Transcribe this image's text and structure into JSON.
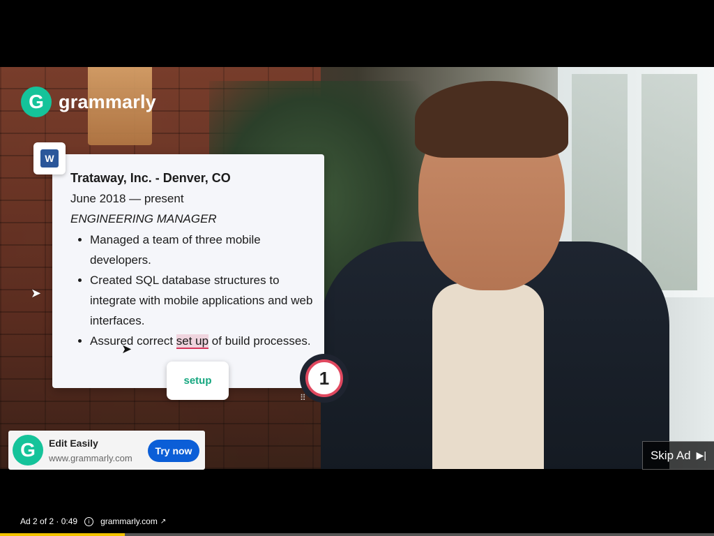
{
  "brand": {
    "name": "grammarly",
    "logo_letter": "G",
    "accent": "#15c39a"
  },
  "resume": {
    "app_icon_letter": "W",
    "company": "Trataway, Inc. - Denver, CO",
    "dates": "June 2018 — present",
    "role": "ENGINEERING MANAGER",
    "bullets": {
      "b1": "Managed a team of three mobile developers.",
      "b2": "Created SQL database structures to integrate with mobile applications and web interfaces.",
      "b3_pre": "Assured correct ",
      "b3_mark": "set up",
      "b3_post": " of build processes."
    },
    "suggestion": "setup",
    "issue_count": "1"
  },
  "ad_card": {
    "title": "Edit Easily",
    "url": "www.grammarly.com",
    "cta": "Try now",
    "cta_color": "#0b5ed7"
  },
  "skip": {
    "label": "Skip Ad",
    "icon": "skip-next-icon"
  },
  "ad_info": {
    "position": "Ad 2 of 2 · 0:49",
    "domain": "grammarly.com",
    "progress": 0.175
  }
}
